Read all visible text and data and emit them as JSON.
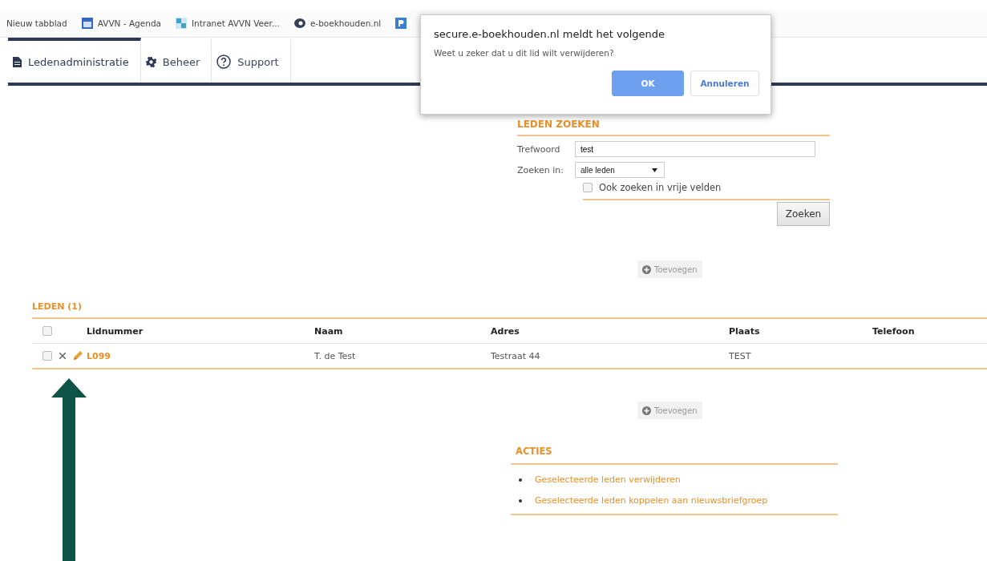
{
  "bookmarks": [
    {
      "label": "Nieuw tabblad",
      "kind": "none"
    },
    {
      "label": "AVVN - Agenda",
      "kind": "calendar"
    },
    {
      "label": "Intranet AVVN Veer...",
      "kind": "site"
    },
    {
      "label": "e-boekhouden.nl",
      "kind": "eye"
    },
    {
      "kind": "parking"
    }
  ],
  "nav": [
    {
      "label": "Ledenadministratie",
      "kind": "document",
      "selected": true
    },
    {
      "label": "Beheer",
      "kind": "gear",
      "selected": false
    },
    {
      "label": "Support",
      "kind": "help",
      "selected": false
    }
  ],
  "dialog": {
    "title": "secure.e-boekhouden.nl meldt het volgende",
    "message": "Weet u zeker dat u dit lid wilt verwijderen?",
    "ok": "OK",
    "cancel": "Annuleren"
  },
  "search": {
    "title": "LEDEN ZOEKEN",
    "keyword_label": "Trefwoord",
    "keyword": "test",
    "scope_label": "Zoeken in:",
    "scope": "alle leden",
    "free_fields": {
      "label": "Ook zoeken in vrije velden",
      "checked": false
    },
    "button": "Zoeken"
  },
  "add_buttons": [
    "Toevoegen",
    "Toevoegen"
  ],
  "members": {
    "title": "LEDEN (1)",
    "all_checked": false,
    "columns": [
      "Lidnummer",
      "Naam",
      "Adres",
      "Plaats",
      "Telefoon"
    ],
    "rows": [
      {
        "checked": false,
        "cells": [
          "L099",
          "T. de Test",
          "Testraat 44",
          "TEST",
          ""
        ]
      }
    ]
  },
  "actions": {
    "title": "ACTIES",
    "links": [
      "Geselecteerde leden verwijderen",
      "Geselecteerde leden koppelen aan nieuwsbriefgroep"
    ]
  }
}
